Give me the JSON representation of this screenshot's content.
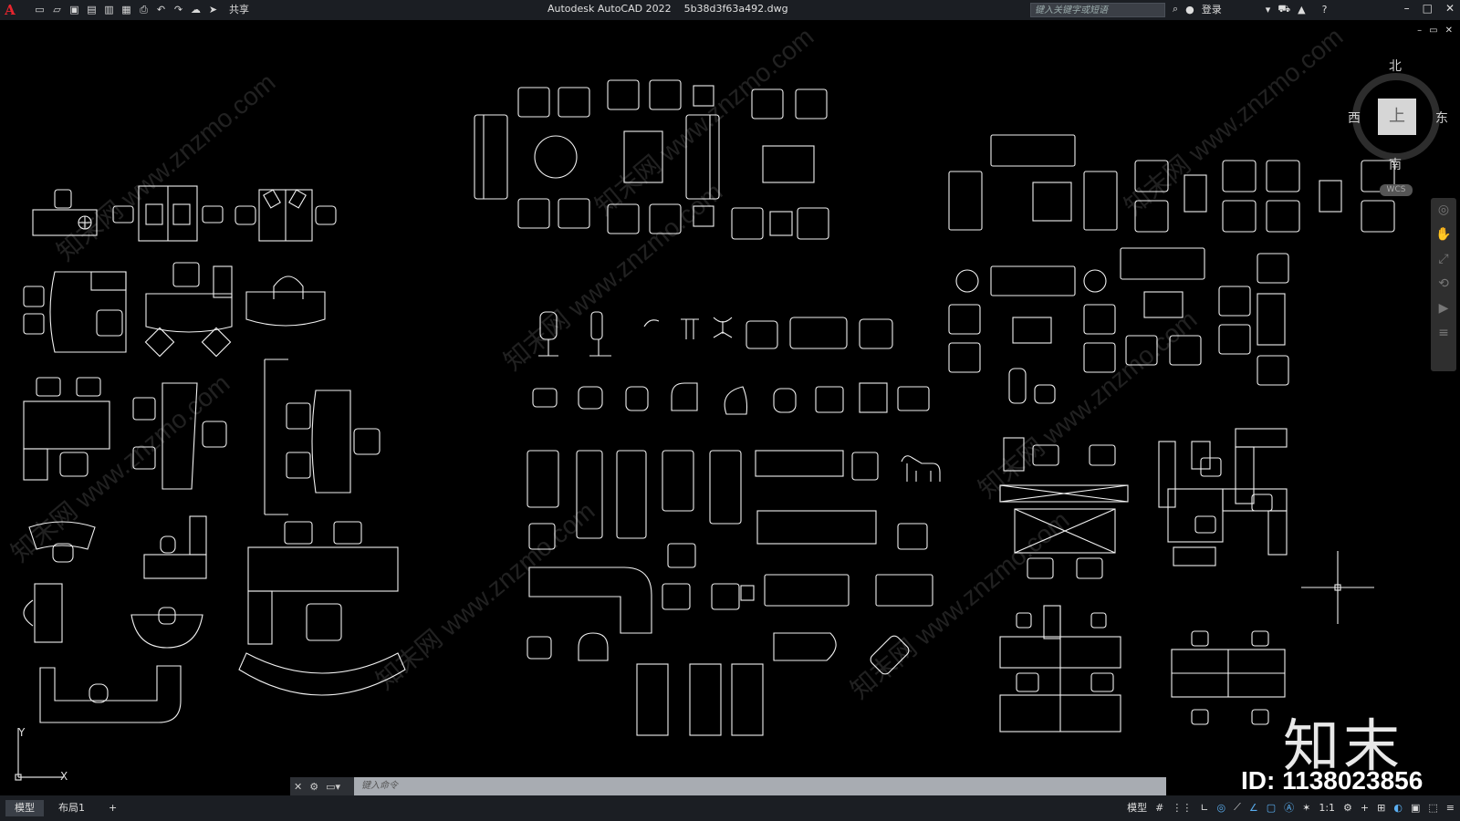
{
  "app": {
    "logo": "A",
    "title": "Autodesk AutoCAD 2022    5b38d3f63a492.dwg",
    "share_label": "共享",
    "search_placeholder": "键入关键字或短语",
    "login_label": "登录"
  },
  "quick_access": [
    "new-icon",
    "open-icon",
    "save-icon",
    "saveas-icon",
    "plot-preview-icon",
    "publish-icon",
    "print-icon",
    "undo-icon",
    "redo-icon",
    "workspace-icon",
    "share-icon"
  ],
  "window_controls": [
    "minimize-icon",
    "restore-icon",
    "close-icon"
  ],
  "viewcube": {
    "north": "北",
    "south": "南",
    "west": "西",
    "east": "东",
    "face": "上",
    "wcs": "WCS"
  },
  "ucs": {
    "x": "X",
    "y": "Y"
  },
  "command": {
    "placeholder": "键入命令"
  },
  "layout_tabs": [
    {
      "label": "模型",
      "active": true
    },
    {
      "label": "布局1",
      "active": false
    }
  ],
  "add_tab": "+",
  "status": {
    "model": "模型",
    "scale": "1:1"
  },
  "watermark": {
    "brand": "知末",
    "id": "ID: 1138023856",
    "text": "知末网 www.znzmo.com"
  },
  "colors": {
    "background": "#000000",
    "linework": "#ffffff",
    "chrome": "#1b1e23",
    "accent": "#5aaef0"
  }
}
